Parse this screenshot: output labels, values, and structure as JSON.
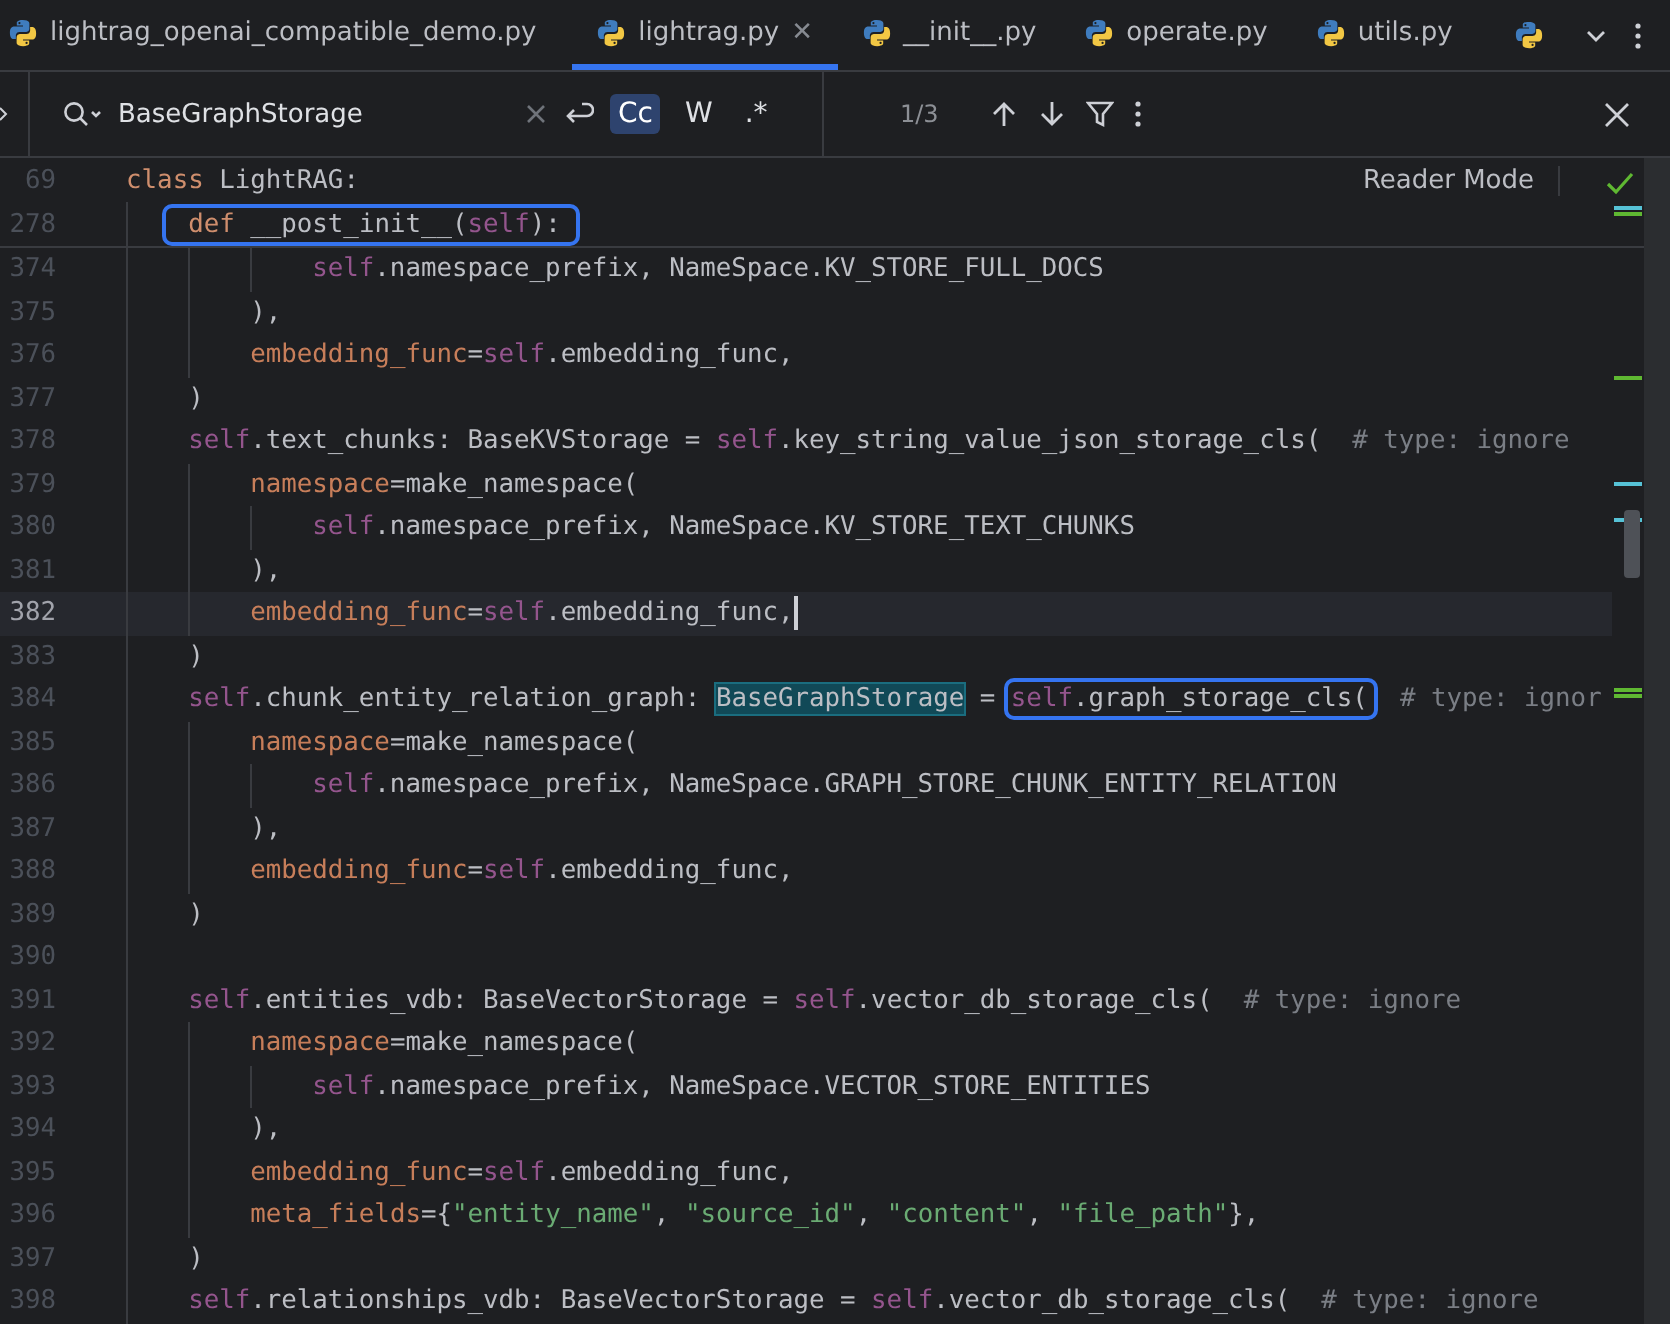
{
  "tabs": [
    {
      "label": "lightrag_openai_compatible_demo.py",
      "selected": false
    },
    {
      "label": "lightrag.py",
      "selected": true,
      "close": "✕"
    },
    {
      "label": "__init__.py",
      "selected": false
    },
    {
      "label": "operate.py",
      "selected": false
    },
    {
      "label": "utils.py",
      "selected": false
    }
  ],
  "search": {
    "value": "BaseGraphStorage",
    "options": [
      {
        "label": "Cc",
        "selected": true
      },
      {
        "label": "W",
        "selected": false
      },
      {
        "label": ".*",
        "selected": false
      }
    ],
    "match_count": "1/3"
  },
  "reader_mode": "Reader Mode",
  "code": {
    "number": "69",
    "tokens": [
      {
        "kind": "kw",
        "text": "class"
      },
      {
        "kind": "plain",
        "text": " LightRAG:"
      }
    ],
    "children": [
      {
        "number": "278",
        "tokens": [
          {
            "kind": "box",
            "children": [
              {
                "kind": "kw",
                "text": "def"
              },
              {
                "kind": "plain",
                "text": " __post_init__("
              },
              {
                "kind": "self",
                "text": "self"
              },
              {
                "kind": "plain",
                "text": "):"
              }
            ]
          }
        ],
        "children": [
          {
            "children": [
              {
                "children": [
                  {
                    "number": "374",
                    "current": false,
                    "caret": false,
                    "tokens": [
                      {
                        "kind": "self",
                        "text": "self"
                      },
                      {
                        "kind": "plain",
                        "text": ".namespace_prefix, NameSpace.KV_STORE_FULL_DOCS"
                      }
                    ]
                  }
                ]
              },
              {
                "number": "375",
                "current": false,
                "caret": false,
                "tokens": [
                  {
                    "kind": "plain",
                    "text": "),"
                  }
                ]
              },
              {
                "number": "376",
                "current": false,
                "caret": false,
                "tokens": [
                  {
                    "kind": "arg",
                    "text": "embedding_func"
                  },
                  {
                    "kind": "plain",
                    "text": "="
                  },
                  {
                    "kind": "self",
                    "text": "self"
                  },
                  {
                    "kind": "plain",
                    "text": ".embedding_func,"
                  }
                ]
              }
            ]
          },
          {
            "number": "377",
            "current": false,
            "caret": false,
            "tokens": [
              {
                "kind": "plain",
                "text": ")"
              }
            ]
          },
          {
            "number": "378",
            "current": false,
            "caret": false,
            "tokens": [
              {
                "kind": "self",
                "text": "self"
              },
              {
                "kind": "plain",
                "text": ".text_chunks: BaseKVStorage = "
              },
              {
                "kind": "self",
                "text": "self"
              },
              {
                "kind": "plain",
                "text": ".key_string_value_json_storage_cls(  "
              },
              {
                "kind": "comment",
                "text": "# type: ignore"
              }
            ],
            "children": [
              {
                "number": "379",
                "current": false,
                "caret": false,
                "tokens": [
                  {
                    "kind": "arg",
                    "text": "namespace"
                  },
                  {
                    "kind": "plain",
                    "text": "=make_namespace("
                  }
                ],
                "children": [
                  {
                    "number": "380",
                    "current": false,
                    "caret": false,
                    "tokens": [
                      {
                        "kind": "self",
                        "text": "self"
                      },
                      {
                        "kind": "plain",
                        "text": ".namespace_prefix, NameSpace.KV_STORE_TEXT_CHUNKS"
                      }
                    ]
                  }
                ]
              },
              {
                "number": "381",
                "current": false,
                "caret": false,
                "tokens": [
                  {
                    "kind": "plain",
                    "text": "),"
                  }
                ]
              },
              {
                "number": "382",
                "current": true,
                "caret": true,
                "tokens": [
                  {
                    "kind": "arg",
                    "text": "embedding_func"
                  },
                  {
                    "kind": "plain",
                    "text": "="
                  },
                  {
                    "kind": "self",
                    "text": "self"
                  },
                  {
                    "kind": "plain",
                    "text": ".embedding_func,"
                  }
                ]
              }
            ]
          },
          {
            "number": "383",
            "current": false,
            "caret": false,
            "tokens": [
              {
                "kind": "plain",
                "text": ")"
              }
            ]
          },
          {
            "number": "384",
            "current": false,
            "caret": false,
            "tokens": [
              {
                "kind": "self",
                "text": "self"
              },
              {
                "kind": "plain",
                "text": ".chunk_entity_relation_graph: "
              },
              {
                "kind": "match",
                "text": "BaseGraphStorage"
              },
              {
                "kind": "plain",
                "text": " = "
              },
              {
                "kind": "box",
                "children": [
                  {
                    "kind": "self",
                    "text": "self"
                  },
                  {
                    "kind": "plain",
                    "text": ".graph_storage_cls("
                  }
                ]
              },
              {
                "kind": "comment",
                "text": "# type: ignor"
              }
            ],
            "children": [
              {
                "number": "385",
                "current": false,
                "caret": false,
                "tokens": [
                  {
                    "kind": "arg",
                    "text": "namespace"
                  },
                  {
                    "kind": "plain",
                    "text": "=make_namespace("
                  }
                ],
                "children": [
                  {
                    "number": "386",
                    "current": false,
                    "caret": false,
                    "tokens": [
                      {
                        "kind": "self",
                        "text": "self"
                      },
                      {
                        "kind": "plain",
                        "text": ".namespace_prefix, NameSpace.GRAPH_STORE_CHUNK_ENTITY_RELATION"
                      }
                    ]
                  }
                ]
              },
              {
                "number": "387",
                "current": false,
                "caret": false,
                "tokens": [
                  {
                    "kind": "plain",
                    "text": "),"
                  }
                ]
              },
              {
                "number": "388",
                "current": false,
                "caret": false,
                "tokens": [
                  {
                    "kind": "arg",
                    "text": "embedding_func"
                  },
                  {
                    "kind": "plain",
                    "text": "="
                  },
                  {
                    "kind": "self",
                    "text": "self"
                  },
                  {
                    "kind": "plain",
                    "text": ".embedding_func,"
                  }
                ]
              }
            ]
          },
          {
            "number": "389",
            "current": false,
            "caret": false,
            "tokens": [
              {
                "kind": "plain",
                "text": ")"
              }
            ]
          },
          {
            "number": "390",
            "current": false,
            "caret": false
          },
          {
            "number": "391",
            "current": false,
            "caret": false,
            "tokens": [
              {
                "kind": "self",
                "text": "self"
              },
              {
                "kind": "plain",
                "text": ".entities_vdb: BaseVectorStorage = "
              },
              {
                "kind": "self",
                "text": "self"
              },
              {
                "kind": "plain",
                "text": ".vector_db_storage_cls(  "
              },
              {
                "kind": "comment",
                "text": "# type: ignore"
              }
            ],
            "children": [
              {
                "number": "392",
                "current": false,
                "caret": false,
                "tokens": [
                  {
                    "kind": "arg",
                    "text": "namespace"
                  },
                  {
                    "kind": "plain",
                    "text": "=make_namespace("
                  }
                ],
                "children": [
                  {
                    "number": "393",
                    "current": false,
                    "caret": false,
                    "tokens": [
                      {
                        "kind": "self",
                        "text": "self"
                      },
                      {
                        "kind": "plain",
                        "text": ".namespace_prefix, NameSpace.VECTOR_STORE_ENTITIES"
                      }
                    ]
                  }
                ]
              },
              {
                "number": "394",
                "current": false,
                "caret": false,
                "tokens": [
                  {
                    "kind": "plain",
                    "text": "),"
                  }
                ]
              },
              {
                "number": "395",
                "current": false,
                "caret": false,
                "tokens": [
                  {
                    "kind": "arg",
                    "text": "embedding_func"
                  },
                  {
                    "kind": "plain",
                    "text": "="
                  },
                  {
                    "kind": "self",
                    "text": "self"
                  },
                  {
                    "kind": "plain",
                    "text": ".embedding_func,"
                  }
                ]
              },
              {
                "number": "396",
                "current": false,
                "caret": false,
                "tokens": [
                  {
                    "kind": "arg",
                    "text": "meta_fields"
                  },
                  {
                    "kind": "plain",
                    "text": "={"
                  },
                  {
                    "kind": "str",
                    "text": "\"entity_name\""
                  },
                  {
                    "kind": "plain",
                    "text": ", "
                  },
                  {
                    "kind": "str",
                    "text": "\"source_id\""
                  },
                  {
                    "kind": "plain",
                    "text": ", "
                  },
                  {
                    "kind": "str",
                    "text": "\"content\""
                  },
                  {
                    "kind": "plain",
                    "text": ", "
                  },
                  {
                    "kind": "str",
                    "text": "\"file_path\""
                  },
                  {
                    "kind": "plain",
                    "text": "},"
                  }
                ]
              }
            ]
          },
          {
            "number": "397",
            "current": false,
            "caret": false,
            "tokens": [
              {
                "kind": "plain",
                "text": ")"
              }
            ]
          },
          {
            "number": "398",
            "current": false,
            "caret": false,
            "tokens": [
              {
                "kind": "self",
                "text": "self"
              },
              {
                "kind": "plain",
                "text": ".relationships_vdb: BaseVectorStorage = "
              },
              {
                "kind": "self",
                "text": "self"
              },
              {
                "kind": "plain",
                "text": ".vector_db_storage_cls(  "
              },
              {
                "kind": "comment",
                "text": "# type: ignore"
              }
            ]
          }
        ]
      }
    ]
  }
}
